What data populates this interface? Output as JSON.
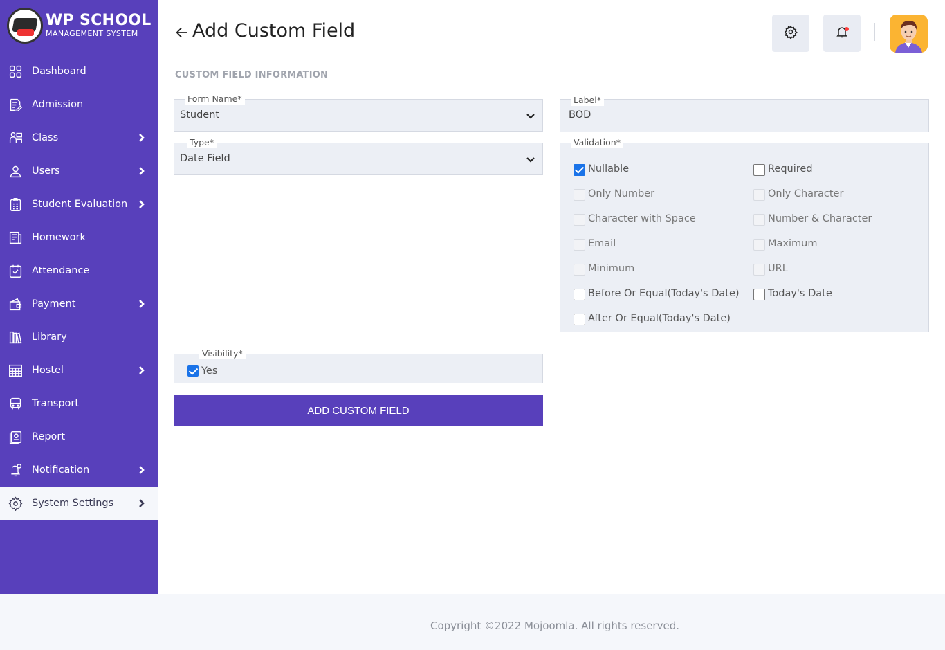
{
  "brand": {
    "title": "WP SCHOOL",
    "subtitle": "MANAGEMENT SYSTEM"
  },
  "sidebar": {
    "items": [
      {
        "label": "Dashboard",
        "icon": "grid-icon",
        "has_submenu": false
      },
      {
        "label": "Admission",
        "icon": "form-edit-icon",
        "has_submenu": false
      },
      {
        "label": "Class",
        "icon": "class-icon",
        "has_submenu": true
      },
      {
        "label": "Users",
        "icon": "user-icon",
        "has_submenu": true
      },
      {
        "label": "Student Evaluation",
        "icon": "clipboard-icon",
        "has_submenu": true
      },
      {
        "label": "Homework",
        "icon": "book-icon",
        "has_submenu": false
      },
      {
        "label": "Attendance",
        "icon": "calendar-check-icon",
        "has_submenu": false
      },
      {
        "label": "Payment",
        "icon": "wallet-icon",
        "has_submenu": true
      },
      {
        "label": "Library",
        "icon": "library-icon",
        "has_submenu": false
      },
      {
        "label": "Hostel",
        "icon": "hostel-icon",
        "has_submenu": true
      },
      {
        "label": "Transport",
        "icon": "bus-icon",
        "has_submenu": false
      },
      {
        "label": "Report",
        "icon": "report-icon",
        "has_submenu": false
      },
      {
        "label": "Notification",
        "icon": "bell-icon",
        "has_submenu": true
      },
      {
        "label": "System Settings",
        "icon": "gear-icon",
        "has_submenu": true,
        "active": true
      }
    ]
  },
  "header": {
    "title": "Add Custom Field"
  },
  "section_title": "CUSTOM FIELD INFORMATION",
  "form": {
    "form_name": {
      "legend": "Form Name*",
      "value": "Student"
    },
    "type": {
      "legend": "Type*",
      "value": "Date Field"
    },
    "label": {
      "legend": "Label*",
      "value": "BOD"
    },
    "validation": {
      "legend": "Validation*",
      "options": [
        {
          "label": "Nullable",
          "checked": true,
          "disabled": false
        },
        {
          "label": "Required",
          "checked": false,
          "disabled": false
        },
        {
          "label": "Only Number",
          "checked": false,
          "disabled": true
        },
        {
          "label": "Only Character",
          "checked": false,
          "disabled": true
        },
        {
          "label": "Character with Space",
          "checked": false,
          "disabled": true
        },
        {
          "label": "Number & Character",
          "checked": false,
          "disabled": true
        },
        {
          "label": "Email",
          "checked": false,
          "disabled": true
        },
        {
          "label": "Maximum",
          "checked": false,
          "disabled": true
        },
        {
          "label": "Minimum",
          "checked": false,
          "disabled": true
        },
        {
          "label": "URL",
          "checked": false,
          "disabled": true
        },
        {
          "label": "Before Or Equal(Today's Date)",
          "checked": false,
          "disabled": false
        },
        {
          "label": "Today's Date",
          "checked": false,
          "disabled": false
        },
        {
          "label": "After Or Equal(Today's Date)",
          "checked": false,
          "disabled": false
        }
      ]
    },
    "visibility": {
      "legend": "Visibility*",
      "option": "Yes",
      "checked": true
    },
    "submit_label": "ADD CUSTOM FIELD"
  },
  "footer": {
    "copyright": "Copyright ©2022 Mojoomla. All rights reserved."
  },
  "colors": {
    "sidebar": "#5840bb",
    "accent": "#1a73e8",
    "avatar_bg": "#fbb432"
  }
}
